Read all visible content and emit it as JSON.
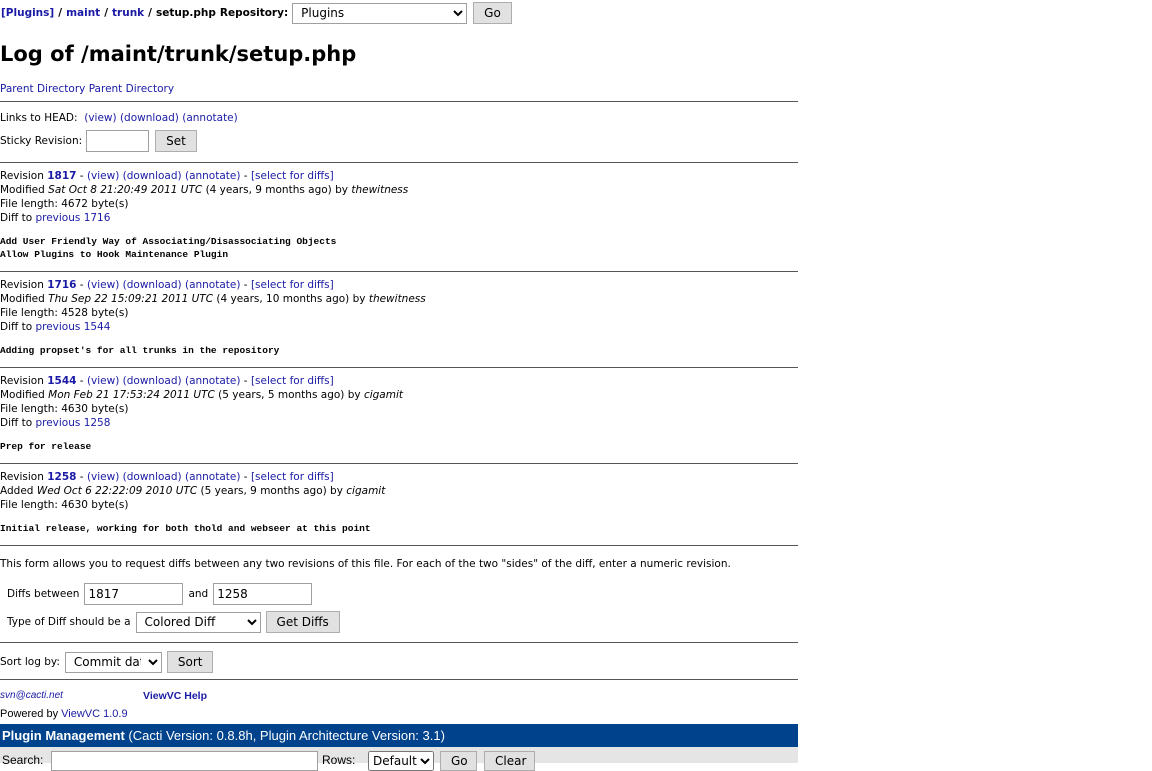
{
  "nav": {
    "root": "[Plugins]",
    "sep": " / ",
    "p1": "maint",
    "p2": "trunk",
    "file": "setup.php",
    "repo_label": "Repository:",
    "repo_value": "Plugins",
    "go": "Go"
  },
  "title": "Log of /maint/trunk/setup.php",
  "parent_links": [
    "Parent Directory",
    "Parent Directory"
  ],
  "head": {
    "label": "Links to HEAD:",
    "view": "(view)",
    "download": "(download)",
    "annotate": "(annotate)"
  },
  "sticky": {
    "label": "Sticky Revision:",
    "value": "",
    "set": "Set"
  },
  "revisions": [
    {
      "num": "1817",
      "action": "Modified",
      "date": "Sat Oct 8 21:20:49 2011 UTC",
      "ago": "(4 years, 9 months ago) by",
      "author": "thewitness",
      "length": "File length: 4672 byte(s)",
      "diff_prev": "previous 1716",
      "msg": "Add User Friendly Way of Associating/Disassociating Objects\nAllow Plugins to Hook Maintenance Plugin"
    },
    {
      "num": "1716",
      "action": "Modified",
      "date": "Thu Sep 22 15:09:21 2011 UTC",
      "ago": "(4 years, 10 months ago) by",
      "author": "thewitness",
      "length": "File length: 4528 byte(s)",
      "diff_prev": "previous 1544",
      "msg": "Adding propset's for all trunks in the repository"
    },
    {
      "num": "1544",
      "action": "Modified",
      "date": "Mon Feb 21 17:53:24 2011 UTC",
      "ago": "(5 years, 5 months ago) by",
      "author": "cigamit",
      "length": "File length: 4630 byte(s)",
      "diff_prev": "previous 1258",
      "msg": "Prep for release"
    },
    {
      "num": "1258",
      "action": "Added",
      "date": "Wed Oct 6 22:22:09 2010 UTC",
      "ago": "(5 years, 9 months ago) by",
      "author": "cigamit",
      "length": "File length: 4630 byte(s)",
      "diff_prev": null,
      "msg": "Initial release, working for both thold and webseer at this point"
    }
  ],
  "rev_labels": {
    "revision": "Revision",
    "dash": " - ",
    "view": "(view)",
    "download": "(download)",
    "annotate": "(annotate)",
    "select": "[select for diffs]",
    "diff_to": "Diff to"
  },
  "diffform": {
    "desc": "This form allows you to request diffs between any two revisions of this file. For each of the two \"sides\" of the diff, enter a numeric revision.",
    "between": "Diffs between",
    "r1": "1817",
    "and": "and",
    "r2": "1258",
    "type_label": "Type of Diff should be a",
    "type_value": "Colored Diff",
    "get": "Get Diffs"
  },
  "sort": {
    "label": "Sort log by:",
    "value": "Commit date",
    "button": "Sort"
  },
  "footer": {
    "email": "svn@cacti.net",
    "help": "ViewVC Help",
    "powered": "Powered by",
    "viewvc": "ViewVC 1.0.9"
  },
  "plugin": {
    "title": "Plugin Management",
    "version": "(Cacti Version: 0.8.8h, Plugin Architecture Version: 3.1)",
    "search": "Search:",
    "rows": "Rows:",
    "rows_value": "Default",
    "go": "Go",
    "clear": "Clear"
  },
  "colors": {
    "link": "#1a1aa6",
    "bar": "#00438c"
  }
}
